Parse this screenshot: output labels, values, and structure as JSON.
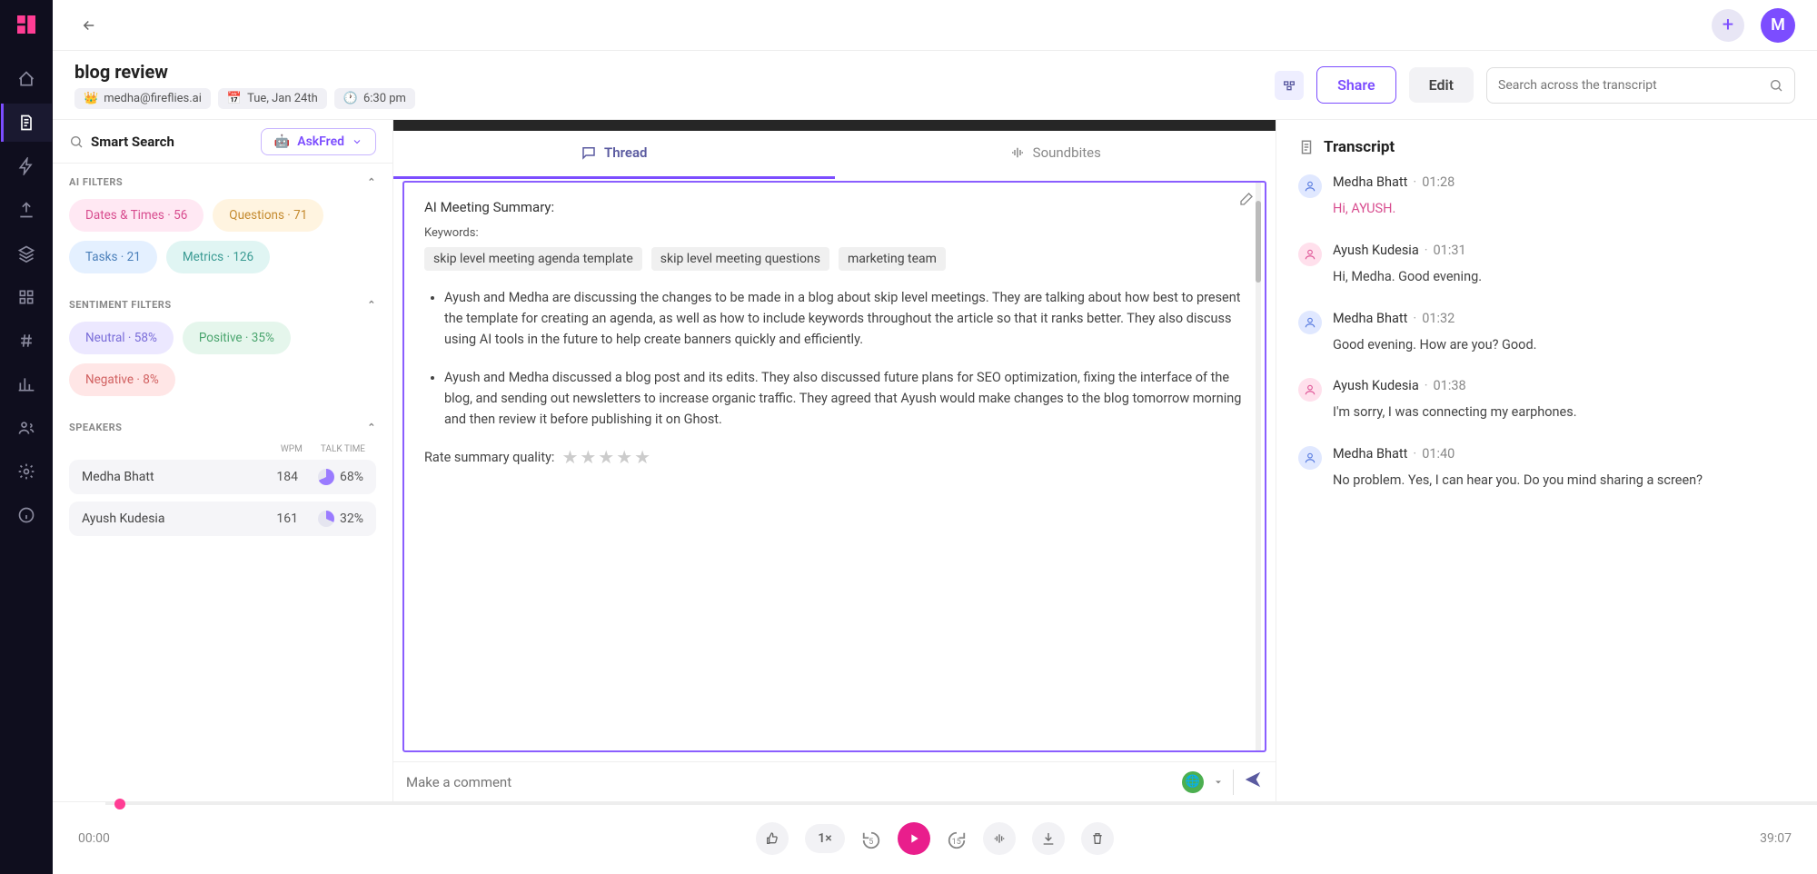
{
  "page_title": "blog review",
  "owner_email": "medha@fireflies.ai",
  "date": "Tue, Jan 24th",
  "time": "6:30 pm",
  "share_label": "Share",
  "edit_label": "Edit",
  "search_placeholder": "Search across the transcript",
  "avatar_initial": "M",
  "smart_search_label": "Smart Search",
  "askfred_label": "AskFred",
  "filters": {
    "ai_title": "AI FILTERS",
    "items": [
      {
        "label": "Dates & Times · 56",
        "cls": "pink"
      },
      {
        "label": "Questions · 71",
        "cls": "yellow"
      },
      {
        "label": "Tasks · 21",
        "cls": "blue"
      },
      {
        "label": "Metrics · 126",
        "cls": "teal"
      }
    ],
    "sentiment_title": "SENTIMENT FILTERS",
    "sentiments": [
      {
        "label": "Neutral · 58%",
        "cls": "lav"
      },
      {
        "label": "Positive · 35%",
        "cls": "green"
      },
      {
        "label": "Negative · 8%",
        "cls": "red"
      }
    ]
  },
  "speakers": {
    "title": "SPEAKERS",
    "col_wpm": "WPM",
    "col_talk": "TALK TIME",
    "rows": [
      {
        "name": "Medha Bhatt",
        "wpm": "184",
        "talk": "68%",
        "color": "#9a7bff"
      },
      {
        "name": "Ayush Kudesia",
        "wpm": "161",
        "talk": "32%",
        "color": "#9a7bff"
      }
    ]
  },
  "tabs": {
    "thread": "Thread",
    "soundbites": "Soundbites"
  },
  "summary": {
    "title": "AI Meeting Summary:",
    "keywords_label": "Keywords:",
    "keywords": [
      "skip level meeting agenda template",
      "skip level meeting questions",
      "marketing team"
    ],
    "bullets": [
      "Ayush and Medha are discussing the changes to be made in a blog about skip level meetings. They are talking about how best to present the template for creating an agenda, as well as how to include keywords throughout the article so that it ranks better. They also discuss using AI tools in the future to help create banners quickly and efficiently.",
      " Ayush and Medha discussed a blog post and its edits. They also discussed future plans for SEO optimization, fixing the interface of the blog, and sending out newsletters to increase organic traffic. They agreed that Ayush would make changes to the blog tomorrow morning and then review it before publishing it on Ghost."
    ],
    "rate_label": "Rate summary quality:"
  },
  "comment_placeholder": "Make a comment",
  "transcript": {
    "title": "Transcript",
    "entries": [
      {
        "speaker": "Medha Bhatt",
        "ts": "01:28",
        "text": "Hi, AYUSH.",
        "av": "blue",
        "hl": true
      },
      {
        "speaker": "Ayush Kudesia",
        "ts": "01:31",
        "text": "Hi, Medha. Good evening.",
        "av": "pink",
        "hl": false
      },
      {
        "speaker": "Medha Bhatt",
        "ts": "01:32",
        "text": "Good evening. How are you? Good.",
        "av": "blue",
        "hl": false
      },
      {
        "speaker": "Ayush Kudesia",
        "ts": "01:38",
        "text": "I'm sorry, I was connecting my earphones.",
        "av": "pink",
        "hl": false
      },
      {
        "speaker": "Medha Bhatt",
        "ts": "01:40",
        "text": "No problem. Yes, I can hear you. Do you mind sharing a screen?",
        "av": "blue",
        "hl": false
      }
    ]
  },
  "player": {
    "current": "00:00",
    "total": "39:07",
    "speed": "1×",
    "skip_back": "5",
    "skip_fwd": "15"
  }
}
